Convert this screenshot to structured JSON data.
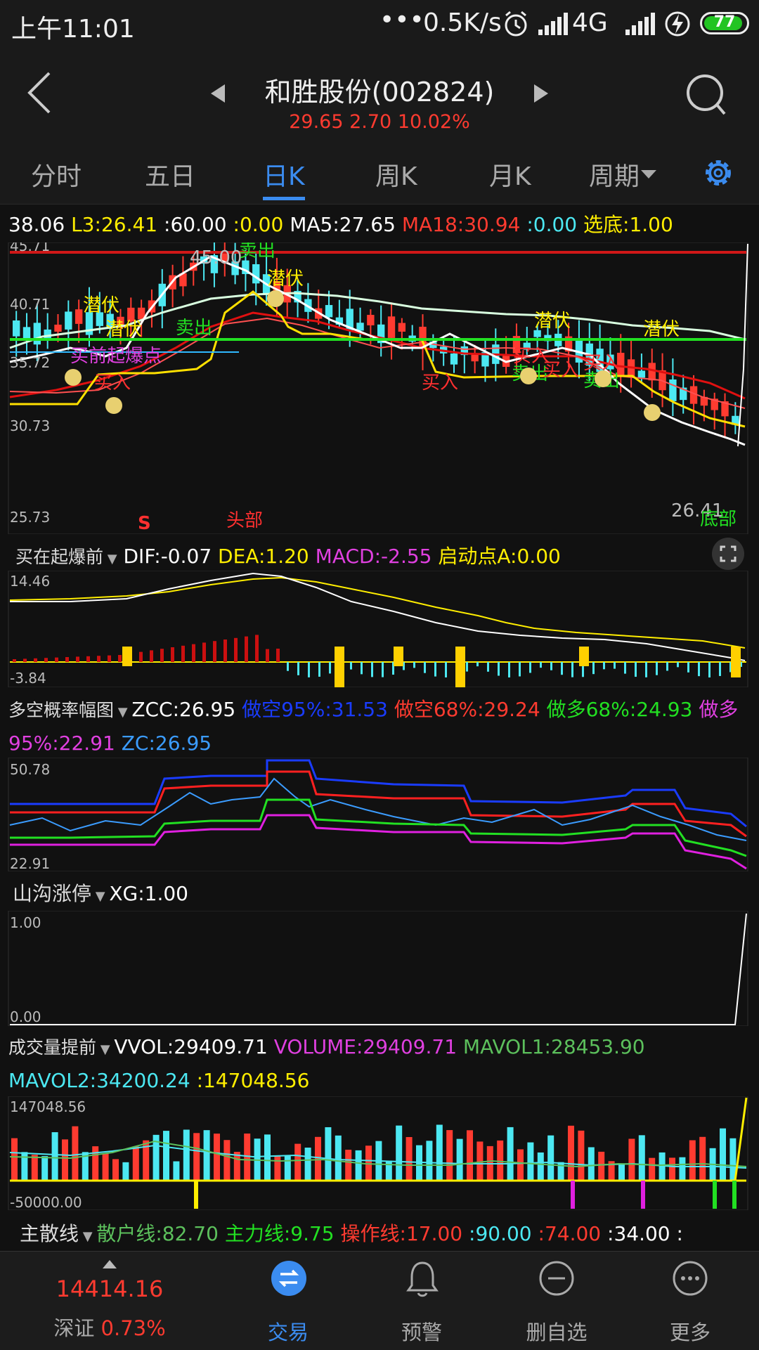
{
  "status_bar": {
    "time": "上午11:01",
    "dots": "•••",
    "speed": "0.5K/s",
    "network": "4G",
    "battery": "77"
  },
  "header": {
    "title": "和胜股份(002824)",
    "price": "29.65",
    "change": "2.70",
    "percent": "10.02%"
  },
  "tabs": [
    "分时",
    "五日",
    "日K",
    "周K",
    "月K",
    "周期"
  ],
  "active_tab": 2,
  "main_indicator": {
    "v1": "38.06",
    "l3_label": "L3:",
    "l3_value": "26.41",
    "a_label": ":",
    "a_value": "60.00",
    "b_label": ":",
    "b_value": "0.00",
    "ma5_label": "MA5:",
    "ma5_value": "27.65",
    "ma18_label": "MA18:",
    "ma18_value": "30.94",
    "c_label": ":",
    "c_value": "0.00",
    "xd_label": "选底:",
    "xd_value": "1.00"
  },
  "main_chart": {
    "y_labels": [
      "45.71",
      "40.71",
      "35.72",
      "30.73",
      "25.73"
    ],
    "annotations": {
      "high": "45.00",
      "low": "26.41",
      "sell": "卖出",
      "lurk": "潜伏",
      "buy": "买入",
      "breakout": "买前起爆点",
      "s": "S",
      "head": "头部",
      "bottom": "底部"
    }
  },
  "macd_panel": {
    "name": "买在起爆前",
    "dif_label": "DIF:",
    "dif_value": "-0.07",
    "dea_label": "DEA:",
    "dea_value": "1.20",
    "macd_label": "MACD:",
    "macd_value": "-2.55",
    "qd_label": "启动点A:",
    "qd_value": "0.00",
    "y_top": "14.46",
    "y_bottom": "-3.84"
  },
  "prob_panel": {
    "name": "多空概率幅图",
    "zcc_label": "ZCC:",
    "zcc_value": "26.95",
    "k95_label": "做空95%:",
    "k95_value": "31.53",
    "k68_label": "做空68%:",
    "k68_value": "29.24",
    "d68_label": "做多68%:",
    "d68_value": "24.93",
    "d95_label": "做多95%:",
    "d95_value": "22.91",
    "zc_label": "ZC:",
    "zc_value": "26.95",
    "y_top": "50.78",
    "y_bottom": "22.91"
  },
  "zt_panel": {
    "name": "山沟涨停",
    "xg_label": "XG:",
    "xg_value": "1.00",
    "y_top": "1.00",
    "y_bottom": "0.00"
  },
  "vol_panel": {
    "name": "成交量提前",
    "vvol_label": "VVOL:",
    "vvol_value": "29409.71",
    "volume_label": "VOLUME:",
    "volume_value": "29409.71",
    "mavol1_label": "MAVOL1:",
    "mavol1_value": "28453.90",
    "mavol2_label": "MAVOL2:",
    "mavol2_value": "34200.24",
    "x_label": ":",
    "x_value": "147048.56",
    "y_top": "147048.56",
    "y_bottom": "-50000.00"
  },
  "sanhu_panel": {
    "name": "主散线",
    "sh_label": "散户线:",
    "sh_value": "82.70",
    "zl_label": "主力线:",
    "zl_value": "9.75",
    "cz_label": "操作线:",
    "cz_value": "17.00",
    "v1": ":90.00",
    "v2": ":74.00",
    "v3": ":34.00",
    "v4": ":"
  },
  "bottom_nav": {
    "index_value": "14414.16",
    "index_name": "深证",
    "index_pct": "0.73%",
    "items": [
      "交易",
      "预警",
      "删自选",
      "更多"
    ]
  },
  "colors": {
    "up": "#ff3b30",
    "down": "#4ce8f2",
    "accent": "#3b8cf0",
    "yellow": "#ffee00",
    "green": "#22e022",
    "magenta": "#e040e0"
  }
}
